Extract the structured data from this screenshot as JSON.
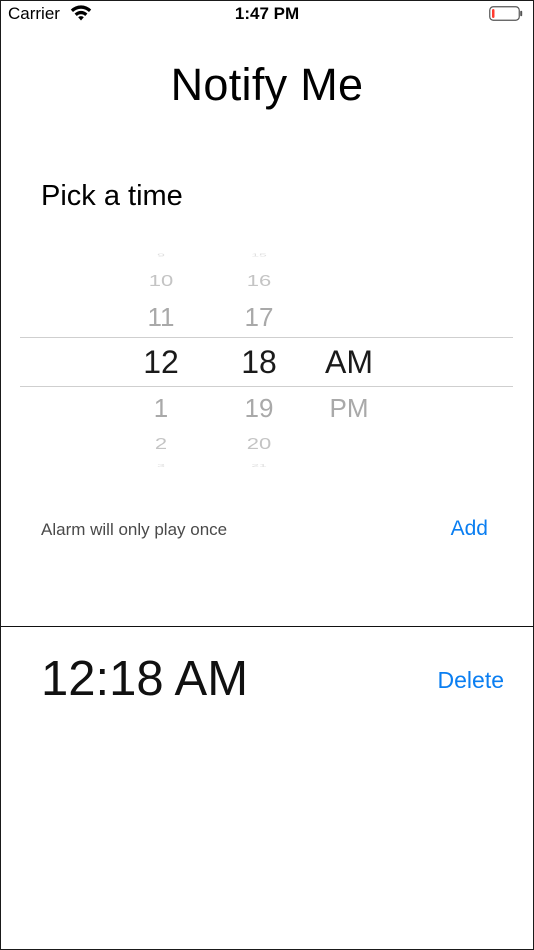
{
  "status_bar": {
    "carrier": "Carrier",
    "time": "1:47 PM",
    "battery_level": 0.1,
    "battery_color": "#ff3b30"
  },
  "header": {
    "title": "Notify Me"
  },
  "picker": {
    "label": "Pick a time",
    "hour_column": {
      "items": [
        "9",
        "10",
        "11",
        "12",
        "1",
        "2",
        "3"
      ],
      "selected": "12"
    },
    "minute_column": {
      "items": [
        "15",
        "16",
        "17",
        "18",
        "19",
        "20",
        "21"
      ],
      "selected": "18"
    },
    "ampm_column": {
      "items": [
        "AM",
        "PM"
      ],
      "selected": "AM"
    }
  },
  "footer": {
    "note": "Alarm will only play once",
    "add_label": "Add"
  },
  "alarms": [
    {
      "time": "12:18 AM",
      "delete_label": "Delete"
    }
  ],
  "colors": {
    "accent": "#0a7ef1",
    "selector_line": "#cfcfcf",
    "divider": "#111111"
  }
}
